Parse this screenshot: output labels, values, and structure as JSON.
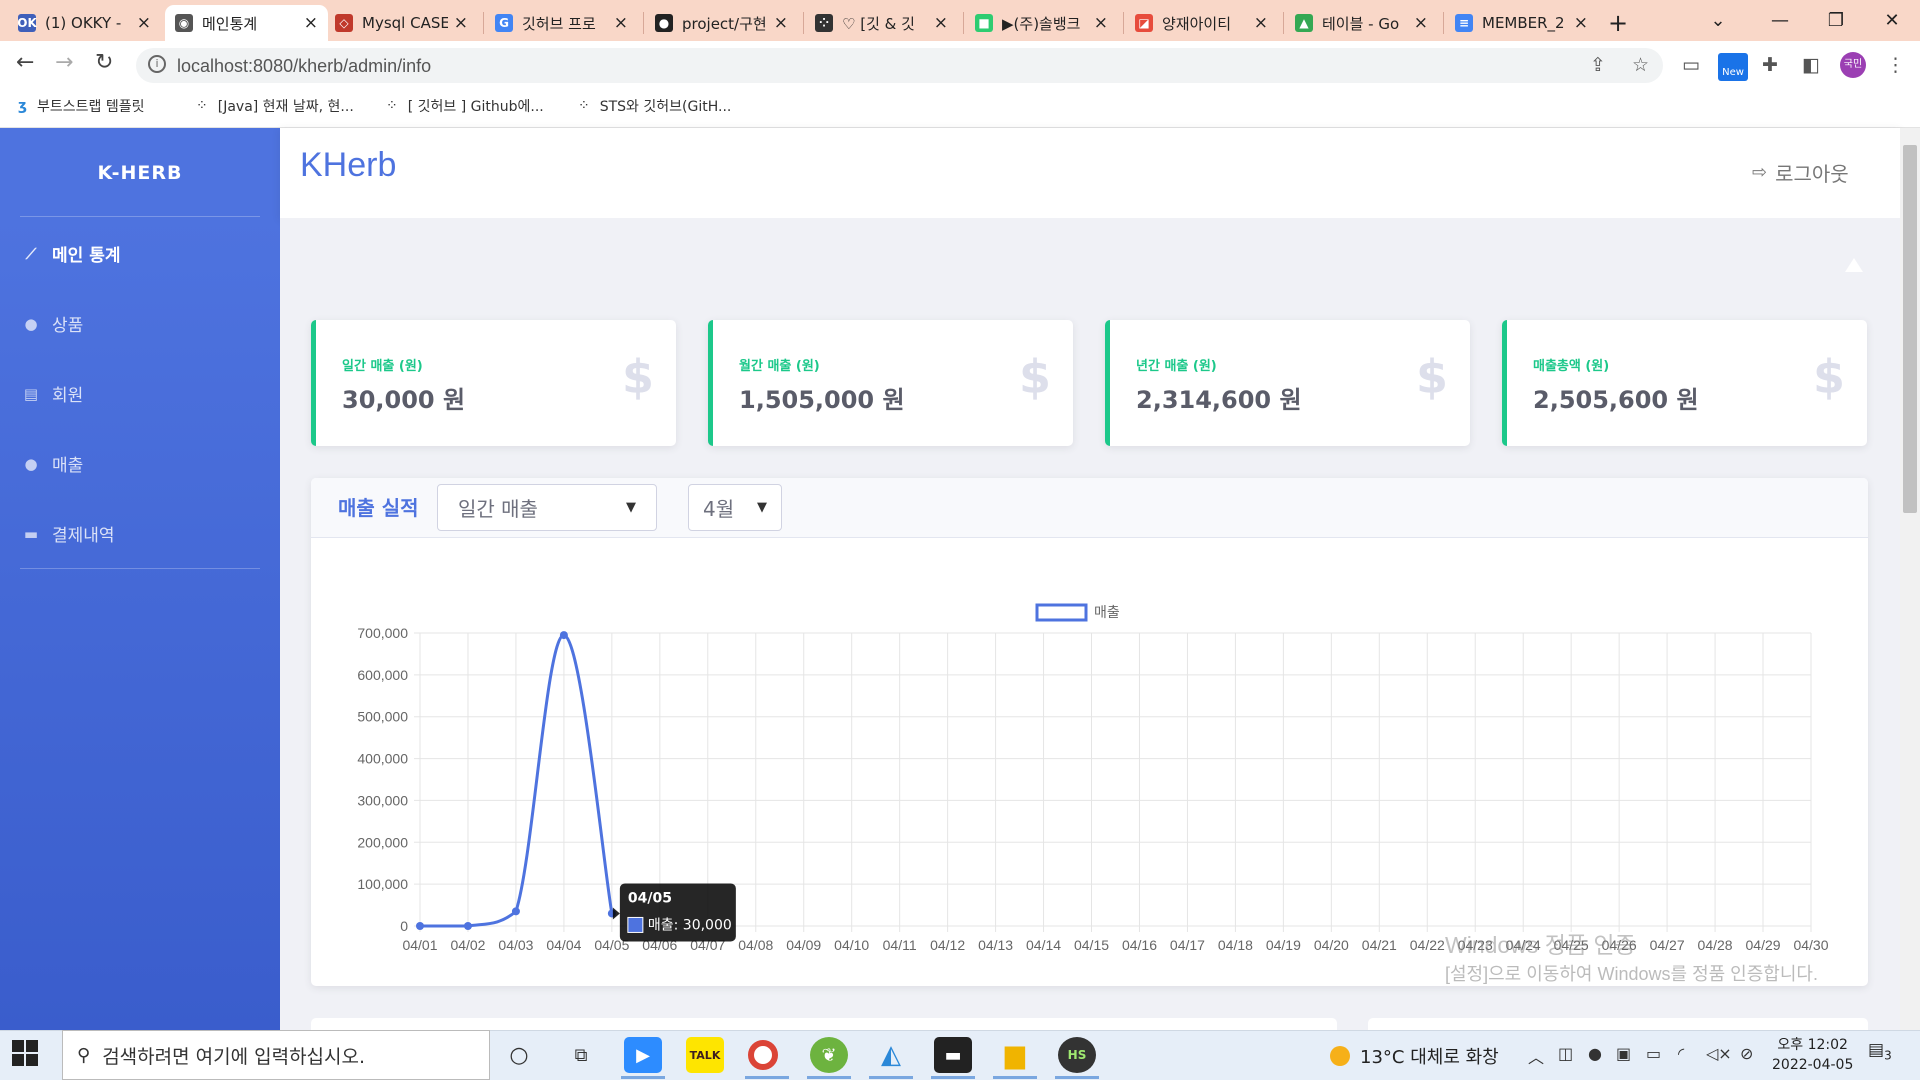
{
  "browser": {
    "tabs": [
      {
        "label": "(1) OKKY -",
        "icon": "okky-icon",
        "color": "#3f5fba",
        "glyph": "OK"
      },
      {
        "label": "메인통계",
        "icon": "globe-icon",
        "color": "#555555",
        "glyph": "◉",
        "active": true
      },
      {
        "label": "Mysql CASE",
        "icon": "diamond-icon",
        "color": "#c0392b",
        "glyph": "◇"
      },
      {
        "label": "깃허브 프로",
        "icon": "google-icon",
        "color": "#4285f4",
        "glyph": "G"
      },
      {
        "label": "project/구현",
        "icon": "github-icon",
        "color": "#222222",
        "glyph": "●"
      },
      {
        "label": "♡ [깃 & 깃",
        "icon": "dots-icon",
        "color": "#333333",
        "glyph": "⁘"
      },
      {
        "label": "▶(주)솔뱅크",
        "icon": "shop-icon",
        "color": "#2ecc71",
        "glyph": "■"
      },
      {
        "label": "양재아이티",
        "icon": "bookmark-icon",
        "color": "#e74c3c",
        "glyph": "◪"
      },
      {
        "label": "테이블 - Go",
        "icon": "drive-icon",
        "color": "#34a853",
        "glyph": "▲"
      },
      {
        "label": "MEMBER_2",
        "icon": "docs-icon",
        "color": "#4285f4",
        "glyph": "≡"
      }
    ],
    "new_tab": "+",
    "url": "localhost:8080/kherb/admin/info",
    "profile": "국민",
    "new_badge": "New",
    "bookmarks": [
      {
        "label": "부트스트랩 템플릿",
        "icon": "bootstrap-icon"
      },
      {
        "label": "[Java] 현재 날짜, 현...",
        "icon": "dots-icon"
      },
      {
        "label": "[ 깃허브 ] Github에...",
        "icon": "dots-icon"
      },
      {
        "label": "STS와 깃허브(GitH...",
        "icon": "dots-icon"
      }
    ]
  },
  "sidebar": {
    "brand": "K-HERB",
    "items": [
      {
        "label": "메인 통계",
        "icon": "chart-area-icon",
        "active": true
      },
      {
        "label": "상품",
        "icon": "product-icon"
      },
      {
        "label": "회원",
        "icon": "id-card-icon"
      },
      {
        "label": "매출",
        "icon": "user-icon"
      },
      {
        "label": "결제내역",
        "icon": "credit-card-icon"
      }
    ]
  },
  "topbar": {
    "logo": "KHerb",
    "logout": "로그아웃"
  },
  "cards": [
    {
      "label": "일간 매출 (원)",
      "value": "30,000 원"
    },
    {
      "label": "월간 매출 (원)",
      "value": "1,505,000 원"
    },
    {
      "label": "년간 매출 (원)",
      "value": "2,314,600 원"
    },
    {
      "label": "매출총액 (원)",
      "value": "2,505,600 원"
    }
  ],
  "sales_panel": {
    "title": "매출 실적",
    "period_select": "일간 매출",
    "month_select": "4월"
  },
  "tooltip": {
    "title": "04/05",
    "body": "매출: 30,000"
  },
  "chart_data": {
    "type": "line",
    "categories": [
      "04/01",
      "04/02",
      "04/03",
      "04/04",
      "04/05",
      "04/06",
      "04/07",
      "04/08",
      "04/09",
      "04/10",
      "04/11",
      "04/12",
      "04/13",
      "04/14",
      "04/15",
      "04/16",
      "04/17",
      "04/18",
      "04/19",
      "04/20",
      "04/21",
      "04/22",
      "04/23",
      "04/24",
      "04/25",
      "04/26",
      "04/27",
      "04/28",
      "04/29",
      "04/30"
    ],
    "series": [
      {
        "name": "매출",
        "values": [
          0,
          0,
          35000,
          695000,
          30000
        ],
        "color": "#4e73df"
      }
    ],
    "ylim": [
      0,
      700000
    ],
    "yticks": [
      0,
      100000,
      200000,
      300000,
      400000,
      500000,
      600000,
      700000
    ],
    "ytick_labels": [
      "0",
      "100,000",
      "200,000",
      "300,000",
      "400,000",
      "500,000",
      "600,000",
      "700,000"
    ],
    "legend": "top",
    "grid": true
  },
  "watermark": {
    "line1": "Windows 정품 인증",
    "line2": "[설정]으로 이동하여 Windows를 정품 인증합니다."
  },
  "taskbar": {
    "search_placeholder": "검색하려면 여기에 입력하십시오.",
    "weather": "13°C  대체로 화창",
    "time": "오후 12:02",
    "date": "2022-04-05",
    "notifications": "3"
  }
}
